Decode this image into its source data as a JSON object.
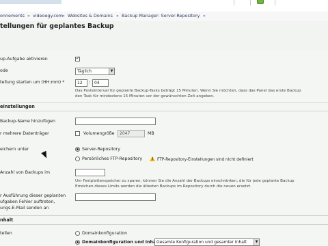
{
  "breadcrumb": {
    "items": [
      "onnements",
      "videoegy.com",
      "Websites & Domains",
      "Backup Manager: Server-Repository"
    ],
    "separator": "»",
    "trailing": "»"
  },
  "page": {
    "title": "tellungen für geplantes Backup"
  },
  "schedule": {
    "activate_label": "up-Aufgabe aktivieren",
    "mode_label": "ode",
    "mode_value": "Täglich",
    "start_label": "tellung starten um (HH:mm) *",
    "hour": "12",
    "minute": "04",
    "time_sep": ":",
    "hint_line1": "Das Posteinterval für geplante Backup-Tasks beträgt 15 Minuten. Wenn Sie möchten, dass das Panel das erste Backup",
    "hint_line2": "den Task für mindestens 15 Minuten vor der gewünschten Zeit angeben."
  },
  "backup_settings": {
    "heading": "einstellungen",
    "name_label": "Backup-Name hinzufügen",
    "name_value": "",
    "multi_label": "r mehrere Datenträger",
    "volume_label": "Volumengröße",
    "volume_value": "2047",
    "volume_unit": "MB",
    "store_label": "eichern unter",
    "server_repo": "Server-Repository",
    "ftp_repo": "Persönliches FTP-Repository",
    "ftp_warning": "FTP-Repository-Einstellungen sind nicht definiert",
    "count_label": "Anzahl von Backups im",
    "count_value": "",
    "count_hint1": "Um Festplattenspeicher zu sparen, können Sie die Anzahl der Backups einschränken, die für jede geplante Backup",
    "count_hint2": "Erreichen dieses Limits werden die ältesten Backups im Repository durch die neuen ersetzt.",
    "errors_label1": "r Ausführung dieser geplanten",
    "errors_label2": "ufgaben Fehler auftreten,",
    "errors_label3": "ungs-E-Mail senden an",
    "email_value": ""
  },
  "content": {
    "heading": "nhalt",
    "save_label": "tellen",
    "option_domain_config": "Domainkonfiguration",
    "option_domain_config_content": "Domainkonfiguration und Inhalt",
    "content_select_value": "Gesamte Konfiguration und gesamter Inhalt"
  },
  "colors": {
    "link": "#2d3a66",
    "warning": "#f0b000",
    "topbar_green": "#6fb53f"
  }
}
